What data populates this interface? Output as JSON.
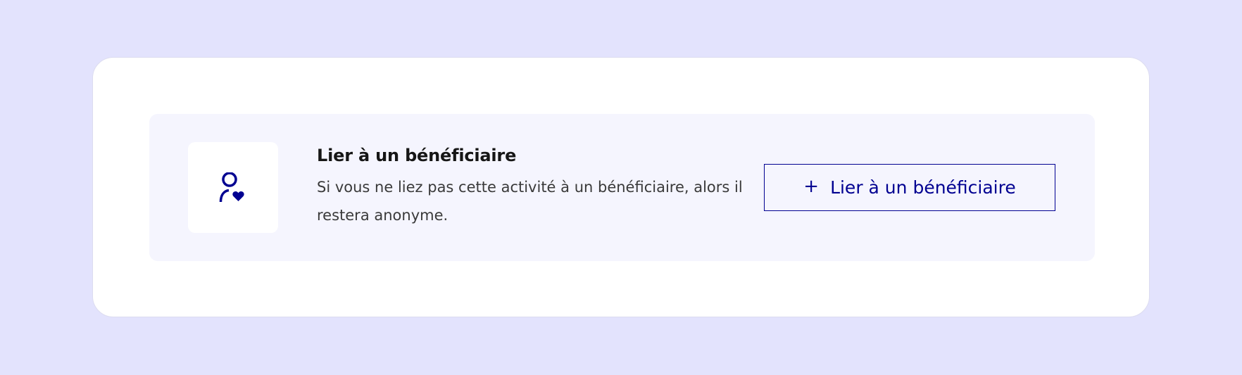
{
  "beneficiary_card": {
    "title": "Lier à un bénéficiaire",
    "description": "Si vous ne liez pas cette activité à un bénéficiaire, alors il restera anonyme.",
    "icon": "user-heart-icon",
    "button": {
      "label": "Lier à un bénéficiaire",
      "icon": "plus-icon",
      "icon_glyph": "+"
    }
  },
  "colors": {
    "page_background": "#e3e3fd",
    "card_background": "#ffffff",
    "panel_background": "#f5f5fe",
    "accent": "#000091",
    "title_text": "#161616",
    "body_text": "#3a3a3a"
  }
}
